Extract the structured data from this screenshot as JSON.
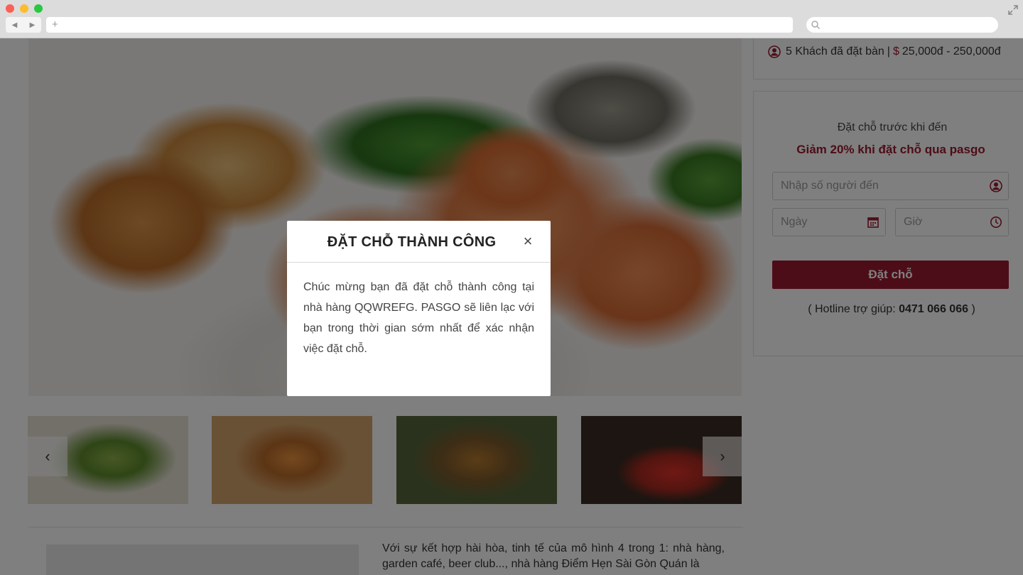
{
  "sidebar": {
    "guests_booked": "5 Khách đã đặt bàn",
    "separator": "|",
    "currency_symbol": "$",
    "price_range": "25,000đ - 250,000đ",
    "pre_booking_text": "Đặt chỗ trước khi đến",
    "promo_text": "Giảm 20% khi đặt chỗ qua pasgo",
    "people_placeholder": "Nhập số người đến",
    "date_placeholder": "Ngày",
    "time_placeholder": "Giờ",
    "book_button": "Đặt chỗ",
    "hotline_prefix": "( Hotline trợ giúp:",
    "hotline_number": "0471 066 066",
    "hotline_suffix": ")"
  },
  "carousel": {
    "prev_icon": "‹",
    "next_icon": "›"
  },
  "description": {
    "text": "Với sự kết hợp hài hòa, tinh tế của mô hình 4 trong 1: nhà hàng, garden café, beer club..., nhà hàng Điểm Hẹn Sài Gòn Quán là"
  },
  "modal": {
    "title": "ĐẶT CHỖ THÀNH CÔNG",
    "close_icon": "×",
    "message": "Chúc mừng bạn đã đặt chỗ thành công tại nhà hàng QQWREFG. PASGO sẽ liên lạc với bạn trong thời gian sớm nhất để xác nhận việc đặt chỗ."
  },
  "colors": {
    "brand": "#9b1b30",
    "overlay": "rgba(0,0,0,0.5)"
  }
}
